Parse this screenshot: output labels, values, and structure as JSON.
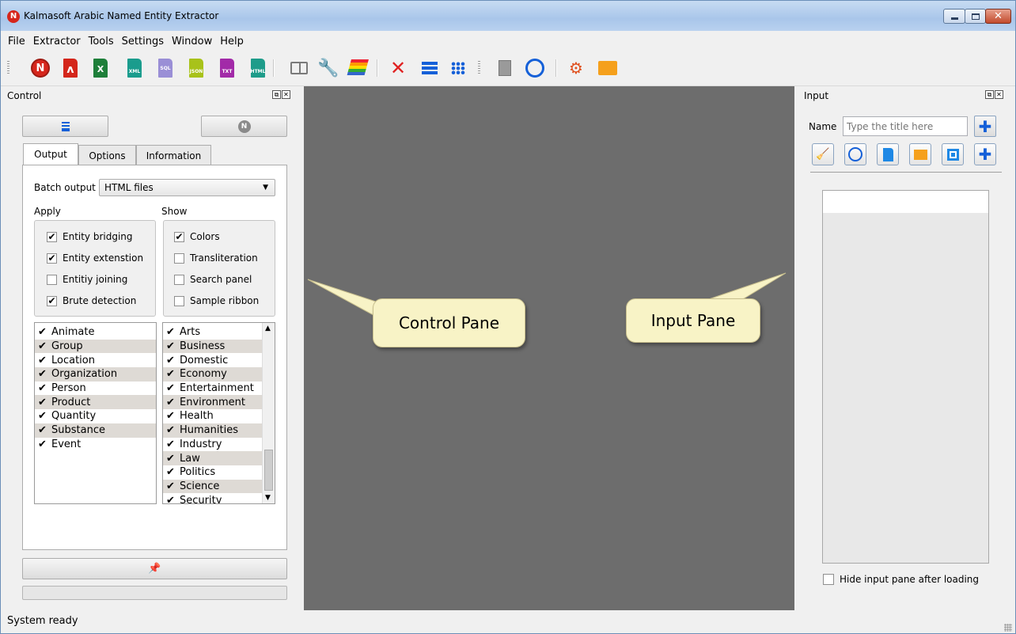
{
  "window": {
    "title": "Kalmasoft Arabic Named Entity Extractor",
    "app_icon_letter": "N"
  },
  "menu": [
    "File",
    "Extractor",
    "Tools",
    "Settings",
    "Window",
    "Help"
  ],
  "toolbar": {
    "icons": [
      "kalmasoft-n-icon",
      "pdf-icon",
      "excel-icon",
      "xml-file-icon",
      "sql-file-icon",
      "json-file-icon",
      "txt-file-icon",
      "html-file-icon",
      "book-icon",
      "tools-icon",
      "layers-icon",
      "close-red-x-icon",
      "list-lines-icon",
      "grid-icon",
      "document-list-icon",
      "book-circle-icon",
      "gears-icon",
      "folder-icon"
    ],
    "doc_labels": {
      "xml": "XML",
      "sql": "SQL",
      "json": "JSON",
      "txt": "TXT",
      "html": "HTML",
      "excel": "X"
    }
  },
  "control_pane": {
    "title": "Control",
    "tabs": [
      "Output",
      "Options",
      "Information"
    ],
    "active_tab": "Output",
    "batch_output_label": "Batch output",
    "batch_output_value": "HTML files",
    "apply_label": "Apply",
    "show_label": "Show",
    "apply_options": [
      {
        "label": "Entity bridging",
        "checked": true
      },
      {
        "label": "Entity extenstion",
        "checked": true
      },
      {
        "label": "Entitiy joining",
        "checked": false
      },
      {
        "label": "Brute detection",
        "checked": true
      }
    ],
    "show_options": [
      {
        "label": "Colors",
        "checked": true
      },
      {
        "label": "Transliteration",
        "checked": false
      },
      {
        "label": "Search panel",
        "checked": false
      },
      {
        "label": "Sample ribbon",
        "checked": false
      }
    ],
    "entity_types": [
      "Animate",
      "Group",
      "Location",
      "Organization",
      "Person",
      "Product",
      "Quantity",
      "Substance",
      "Event"
    ],
    "domains": [
      "Arts",
      "Business",
      "Domestic",
      "Economy",
      "Entertainment",
      "Environment",
      "Health",
      "Humanities",
      "Industry",
      "Law",
      "Politics",
      "Science",
      "Security"
    ],
    "check_glyph": "✔"
  },
  "callouts": {
    "control": "Control Pane",
    "input": "Input Pane"
  },
  "input_pane": {
    "title": "Input",
    "name_label": "Name",
    "name_placeholder": "Type the title here",
    "hide_after_loading_label": "Hide input pane after loading"
  },
  "status": {
    "text": "System ready"
  }
}
